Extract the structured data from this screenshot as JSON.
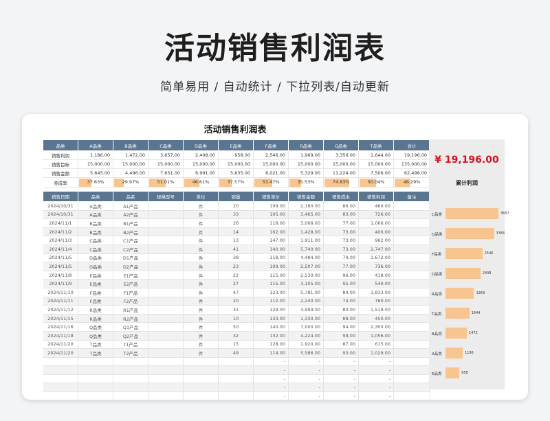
{
  "page": {
    "title": "活动销售利润表",
    "subtitle": "简单易用  /  自动统计  /  下拉列表/自动更新"
  },
  "sheet": {
    "title": "活动销售利润表"
  },
  "summary": {
    "headers": [
      "品类",
      "A品类",
      "B品类",
      "C品类",
      "D品类",
      "E品类",
      "F品类",
      "R品类",
      "Q品类",
      "T品类",
      "合计"
    ],
    "rows": [
      {
        "label": "销售利润",
        "values": [
          "1,186.00",
          "1,472.00",
          "3,657.00",
          "2,408.00",
          "958.00",
          "2,546.00",
          "1,969.00",
          "3,356.00",
          "1,644.00",
          "19,196.00"
        ]
      },
      {
        "label": "销售目标",
        "values": [
          "15,000.00",
          "15,000.00",
          "15,000.00",
          "15,000.00",
          "15,000.00",
          "15,000.00",
          "15,000.00",
          "15,000.00",
          "15,000.00",
          "135,000.00"
        ]
      },
      {
        "label": "销售金额",
        "values": [
          "5,645.00",
          "4,496.00",
          "7,651.00",
          "6,991.00",
          "5,635.00",
          "8,021.00",
          "5,329.00",
          "11,224.00",
          "7,506.00",
          "62,498.00"
        ]
      }
    ],
    "rate_label": "完成率",
    "rates": [
      "37.63%",
      "29.97%",
      "51.01%",
      "46.61%",
      "37.57%",
      "53.47%",
      "35.53%",
      "74.83%",
      "50.04%",
      "46.29%"
    ],
    "rate_values": [
      0.3763,
      0.2997,
      0.5101,
      0.4661,
      0.3757,
      0.5347,
      0.3553,
      0.7483,
      0.5004,
      0.4629
    ]
  },
  "detail": {
    "headers": [
      "销售日期",
      "品类",
      "品名",
      "规格型号",
      "单位",
      "销量",
      "销售单价",
      "销售金额",
      "销售成本",
      "销售利润",
      "备注"
    ],
    "rows": [
      [
        "2024/10/31",
        "A品类",
        "A1产品",
        "",
        "件",
        "20",
        "109.00",
        "2,180.00",
        "86.00",
        "460.00",
        ""
      ],
      [
        "2024/10/31",
        "A品类",
        "A2产品",
        "",
        "件",
        "33",
        "105.00",
        "3,465.00",
        "83.00",
        "726.00",
        ""
      ],
      [
        "2024/11/1",
        "B品类",
        "B1产品",
        "",
        "件",
        "26",
        "118.00",
        "3,068.00",
        "77.00",
        "1,066.00",
        ""
      ],
      [
        "2024/11/2",
        "B品类",
        "B2产品",
        "",
        "件",
        "14",
        "102.00",
        "1,428.00",
        "73.00",
        "406.00",
        ""
      ],
      [
        "2024/11/3",
        "C品类",
        "C1产品",
        "",
        "件",
        "13",
        "147.00",
        "1,911.00",
        "73.00",
        "962.00",
        ""
      ],
      [
        "2024/11/4",
        "C品类",
        "C2产品",
        "",
        "件",
        "41",
        "140.00",
        "5,740.00",
        "73.00",
        "2,747.00",
        ""
      ],
      [
        "2024/11/5",
        "D品类",
        "D1产品",
        "",
        "件",
        "38",
        "118.00",
        "4,484.00",
        "74.00",
        "1,672.00",
        ""
      ],
      [
        "2024/11/5",
        "D品类",
        "D2产品",
        "",
        "件",
        "23",
        "109.00",
        "2,507.00",
        "77.00",
        "736.00",
        ""
      ],
      [
        "2024/11/8",
        "E品类",
        "E1产品",
        "",
        "件",
        "22",
        "115.00",
        "2,530.00",
        "96.00",
        "418.00",
        ""
      ],
      [
        "2024/11/9",
        "E品类",
        "E2产品",
        "",
        "件",
        "27",
        "115.00",
        "3,105.00",
        "95.00",
        "540.00",
        ""
      ],
      [
        "2024/11/10",
        "F品类",
        "F1产品",
        "",
        "件",
        "47",
        "123.00",
        "5,781.00",
        "84.00",
        "1,833.00",
        ""
      ],
      [
        "2024/11/11",
        "F品类",
        "F2产品",
        "",
        "件",
        "20",
        "112.00",
        "2,240.00",
        "74.00",
        "760.00",
        ""
      ],
      [
        "2024/11/12",
        "R品类",
        "R1产品",
        "",
        "件",
        "31",
        "129.00",
        "3,999.00",
        "80.00",
        "1,519.00",
        ""
      ],
      [
        "2024/11/15",
        "R品类",
        "R2产品",
        "",
        "件",
        "10",
        "133.00",
        "1,330.00",
        "88.00",
        "450.00",
        ""
      ],
      [
        "2024/11/16",
        "Q品类",
        "Q1产品",
        "",
        "件",
        "50",
        "140.00",
        "7,000.00",
        "94.00",
        "2,300.00",
        ""
      ],
      [
        "2024/11/18",
        "Q品类",
        "Q2产品",
        "",
        "件",
        "32",
        "132.00",
        "4,224.00",
        "99.00",
        "1,056.00",
        ""
      ],
      [
        "2024/11/20",
        "T品类",
        "T1产品",
        "",
        "件",
        "15",
        "128.00",
        "1,920.00",
        "87.00",
        "615.00",
        ""
      ],
      [
        "2024/11/20",
        "T品类",
        "T2产品",
        "",
        "件",
        "49",
        "114.00",
        "5,586.00",
        "93.00",
        "1,029.00",
        ""
      ],
      [
        "",
        "",
        "",
        "",
        "",
        "",
        "-",
        "-",
        "-",
        "-",
        ""
      ],
      [
        "",
        "",
        "",
        "",
        "",
        "",
        "-",
        "-",
        "-",
        "-",
        ""
      ],
      [
        "",
        "",
        "",
        "",
        "",
        "",
        "-",
        "-",
        "-",
        "-",
        ""
      ],
      [
        "",
        "",
        "",
        "",
        "",
        "",
        "-",
        "-",
        "-",
        "-",
        ""
      ],
      [
        "",
        "",
        "",
        "",
        "",
        "",
        "-",
        "-",
        "-",
        "-",
        ""
      ],
      [
        "",
        "",
        "",
        "",
        "",
        "",
        "-",
        "-",
        "-",
        "-",
        ""
      ]
    ]
  },
  "side": {
    "total": "¥ 19,196.00",
    "title": "累计利润"
  },
  "chart_data": {
    "type": "bar",
    "orientation": "horizontal",
    "title": "累计利润",
    "categories": [
      "C品类",
      "Q品类",
      "F品类",
      "D品类",
      "R品类",
      "T品类",
      "B品类",
      "A品类",
      "E品类"
    ],
    "values": [
      3657,
      3356,
      2546,
      2408,
      1969,
      1644,
      1472,
      1186,
      958
    ],
    "bar_color": "#f8c48f"
  }
}
